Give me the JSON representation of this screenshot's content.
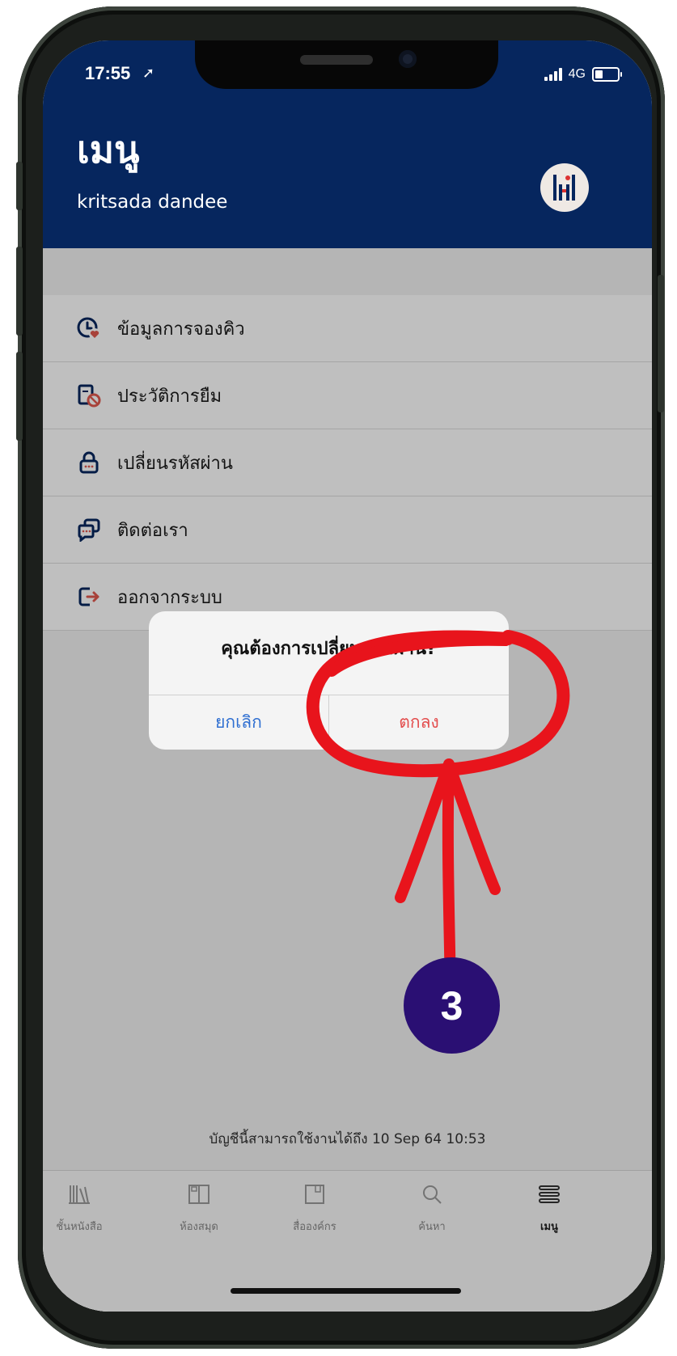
{
  "status_bar": {
    "time": "17:55",
    "location_arrow": "➚",
    "network": "4G"
  },
  "header": {
    "title": "เมนู",
    "subtitle": "kritsada dandee",
    "avatar_icon": "library-logo-icon"
  },
  "menu": {
    "items": [
      {
        "label": "ข้อมูลการจองคิว",
        "icon": "queue-clock-icon"
      },
      {
        "label": "ประวัติการยืม",
        "icon": "borrow-history-icon"
      },
      {
        "label": "เปลี่ยนรหัสผ่าน",
        "icon": "lock-icon"
      },
      {
        "label": "ติดต่อเรา",
        "icon": "chat-icon"
      },
      {
        "label": "ออกจากระบบ",
        "icon": "logout-icon"
      }
    ]
  },
  "footer": {
    "account_expiry": "บัญชีนี้สามารถใช้งานได้ถึง 10 Sep 64 10:53"
  },
  "tabbar": {
    "tabs": [
      {
        "label": "ชั้นหนังสือ",
        "icon": "bookshelf-icon"
      },
      {
        "label": "ห้องสมุด",
        "icon": "library-icon"
      },
      {
        "label": "สื่อองค์กร",
        "icon": "org-media-icon"
      },
      {
        "label": "ค้นหา",
        "icon": "search-icon"
      },
      {
        "label": "เมนู",
        "icon": "menu-icon"
      }
    ],
    "active": "เมนู"
  },
  "dialog": {
    "title": "คุณต้องการเปลี่ยนรหัสผ่าน?",
    "cancel_label": "ยกเลิก",
    "ok_label": "ตกลง"
  },
  "annotation": {
    "step_number": "3",
    "highlight_color": "#e8141c",
    "badge_color": "#2a0f73"
  },
  "colors": {
    "header_bg": "#06265e",
    "cancel_text": "#2f6fd1",
    "ok_text": "#e34d4d"
  }
}
